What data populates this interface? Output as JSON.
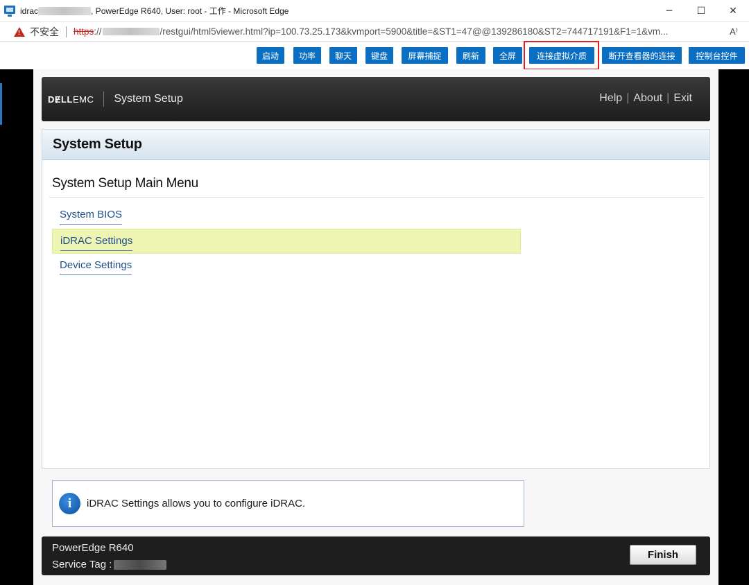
{
  "window": {
    "title_prefix": "idrac",
    "title_suffix": ", PowerEdge R640, User: root - 工作 - Microsoft Edge",
    "minimize": "─",
    "maximize": "☐",
    "close": "✕"
  },
  "address_bar": {
    "insecure_label": "不安全",
    "https": "https",
    "slashes": "://",
    "url_rest": "/restgui/html5viewer.html?ip=100.73.25.173&kvmport=5900&title=&ST1=47@@139286180&ST2=744717191&F1=1&vm...",
    "read_aloud": "A⁾"
  },
  "toolbar": {
    "buttons": [
      "启动",
      "功率",
      "聊天",
      "键盘",
      "屏幕捕捉",
      "刷新",
      "全屏",
      "连接虚拟介质",
      "断开查看器的连接",
      "控制台控件"
    ],
    "highlighted": "连接虚拟介质"
  },
  "setup": {
    "brand_dell": "DɆLL",
    "brand_emc": "EMC",
    "header_title": "System Setup",
    "links": [
      "Help",
      "About",
      "Exit"
    ],
    "panel_title": "System Setup",
    "menu_title": "System Setup Main Menu",
    "menu_items": [
      "System BIOS",
      "iDRAC Settings",
      "Device Settings"
    ],
    "selected_item": "iDRAC Settings",
    "info_icon": "i",
    "info_text": "iDRAC Settings allows you to configure iDRAC.",
    "model": "PowerEdge R640",
    "service_tag_label": "Service Tag :",
    "finish": "Finish"
  },
  "colors": {
    "toolbar_button": "#0a6fc2",
    "highlight_border": "#e02020",
    "selected_row": "#eef5b3",
    "link": "#1d4f8a"
  }
}
